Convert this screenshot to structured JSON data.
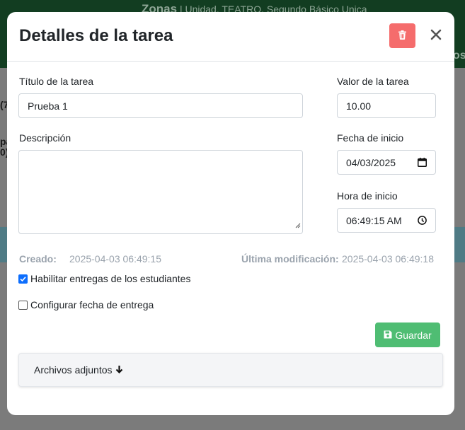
{
  "background": {
    "header_brand": "Zonas",
    "header_subtitle": "| Unidad, TEATRO, Segundo Básico Unica",
    "header_right_fragment": "os",
    "frag1": "(7",
    "frag2": "pa",
    "frag3": "0)"
  },
  "modal": {
    "title": "Detalles de la tarea",
    "delete_icon": "trash-icon",
    "close_icon": "close-icon"
  },
  "form": {
    "title_label": "Título de la tarea",
    "title_value": "Prueba 1",
    "value_label": "Valor de la tarea",
    "value_value": "10.00",
    "description_label": "Descripción",
    "description_value": "",
    "start_date_label": "Fecha de inicio",
    "start_date_value": "04/03/2025",
    "start_time_label": "Hora de inicio",
    "start_time_value": "06:49:15 AM"
  },
  "meta": {
    "created_label": "Creado:",
    "created_value": "2025-04-03 06:49:15",
    "modified_label": "Última modificación:",
    "modified_value": "2025-04-03 06:49:18"
  },
  "options": {
    "enable_submissions_label": "Habilitar entregas de los estudiantes",
    "enable_submissions_checked": true,
    "configure_due_label": "Configurar fecha de entrega",
    "configure_due_checked": false
  },
  "actions": {
    "save_label": "Guardar",
    "save_icon": "floppy-disk-icon"
  },
  "attachments": {
    "label": "Archivos adjuntos",
    "icon": "arrow-down-icon"
  },
  "colors": {
    "accent": "#0d6efd",
    "danger": "#f56c6c",
    "success": "#4fbd73"
  }
}
